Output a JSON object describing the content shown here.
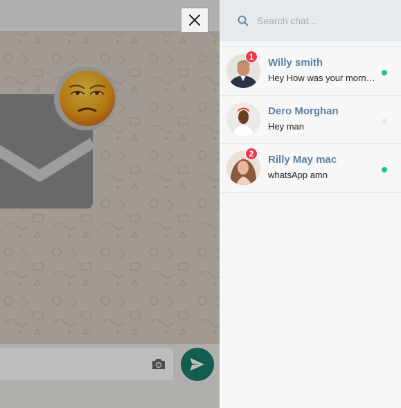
{
  "search": {
    "placeholder": "Search chat..."
  },
  "contacts": [
    {
      "name": "Willy smith",
      "preview": "Hey How was your morning",
      "unread": "1",
      "status_color": "#23c27a"
    },
    {
      "name": "Dero Morghan",
      "preview": "Hey man",
      "unread": "",
      "status_color": "#e8e8e8"
    },
    {
      "name": "Rilly May mac",
      "preview": "whatsApp amn",
      "unread": "2",
      "status_color": "#23c27a"
    }
  ],
  "colors": {
    "send_button": "#1a7f6e",
    "badge": "#f0384a",
    "contact_name": "#5b7fa6",
    "search_bar": "#e7eaed",
    "online": "#23c27a"
  },
  "icons": {
    "close": "close-icon",
    "search": "search-icon",
    "camera": "camera-icon",
    "send": "send-icon"
  }
}
